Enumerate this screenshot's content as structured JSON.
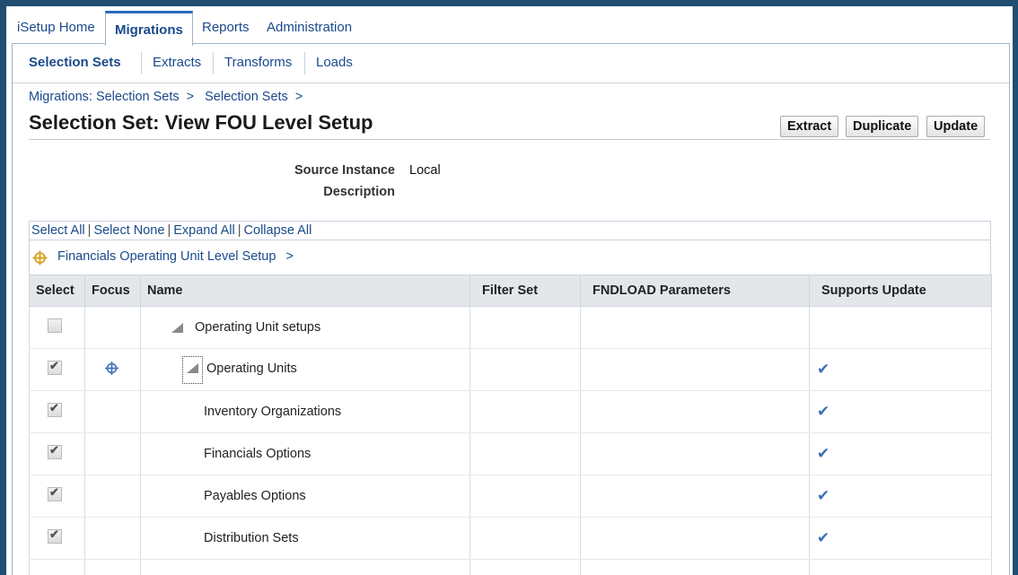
{
  "tabs": [
    "iSetup Home",
    "Migrations",
    "Reports",
    "Administration"
  ],
  "subtabs": [
    "Selection Sets",
    "Extracts",
    "Transforms",
    "Loads"
  ],
  "breadcrumb": [
    "Migrations: Selection Sets",
    "Selection Sets"
  ],
  "breadcrumb_sep": ">",
  "page_title": "Selection Set: View FOU Level Setup",
  "buttons": {
    "extract": "Extract",
    "duplicate": "Duplicate",
    "update": "Update"
  },
  "fields": {
    "source_instance_label": "Source Instance",
    "source_instance_value": "Local",
    "description_label": "Description"
  },
  "table_actions": {
    "select_all": "Select All",
    "select_none": "Select None",
    "expand_all": "Expand All",
    "collapse_all": "Collapse All"
  },
  "focus_path": "Financials Operating Unit Level Setup",
  "focus_sep": ">",
  "columns": [
    "Select",
    "Focus",
    "Name",
    "Filter Set",
    "FNDLOAD Parameters",
    "Supports Update"
  ],
  "rows": [
    {
      "name": "Operating Unit setups",
      "checked": false,
      "disabled": true,
      "focus": false,
      "expand": true,
      "supports_update": false
    },
    {
      "name": "Operating Units",
      "checked": true,
      "disabled": true,
      "focus": true,
      "expand": true,
      "supports_update": true
    },
    {
      "name": "Inventory Organizations",
      "checked": true,
      "disabled": true,
      "focus": false,
      "expand": false,
      "supports_update": true
    },
    {
      "name": "Financials Options",
      "checked": true,
      "disabled": true,
      "focus": false,
      "expand": false,
      "supports_update": true
    },
    {
      "name": "Payables Options",
      "checked": true,
      "disabled": true,
      "focus": false,
      "expand": false,
      "supports_update": true
    },
    {
      "name": "Distribution Sets",
      "checked": true,
      "disabled": true,
      "focus": false,
      "expand": false,
      "supports_update": true
    }
  ],
  "colors": {
    "link": "#1a4a8a",
    "accent_tab": "#2a6ab8",
    "check": "#3a6fb8",
    "frame_bg": "#1f4e72"
  }
}
